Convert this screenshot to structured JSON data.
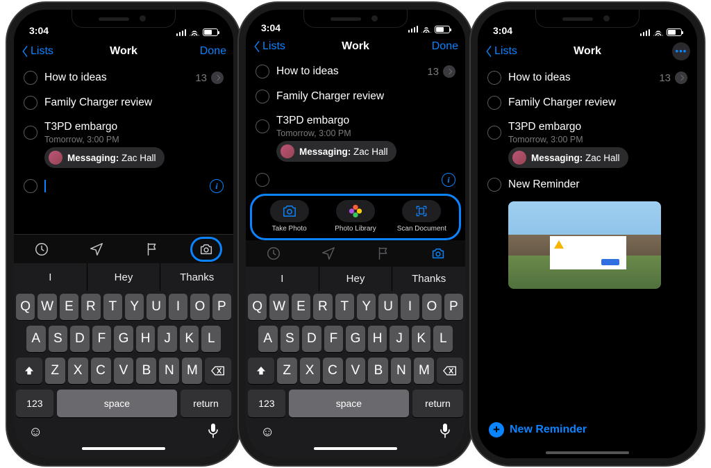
{
  "status": {
    "time": "3:04"
  },
  "nav": {
    "back": "Lists",
    "title": "Work",
    "done": "Done"
  },
  "reminders": [
    {
      "title": "How to ideas",
      "count": "13"
    },
    {
      "title": "Family Charger review"
    },
    {
      "title": "T3PD embargo",
      "sub": "Tomorrow, 3:00 PM"
    }
  ],
  "message_pill": {
    "prefix": "Messaging:",
    "name": "Zac Hall"
  },
  "new_reminder_label": "New Reminder",
  "actions": {
    "take_photo": "Take Photo",
    "photo_library": "Photo Library",
    "scan_document": "Scan Document"
  },
  "predictions": [
    "I",
    "Hey",
    "Thanks"
  ],
  "keyboard": {
    "row1": [
      "Q",
      "W",
      "E",
      "R",
      "T",
      "Y",
      "U",
      "I",
      "O",
      "P"
    ],
    "row2": [
      "A",
      "S",
      "D",
      "F",
      "G",
      "H",
      "J",
      "K",
      "L"
    ],
    "row3": [
      "Z",
      "X",
      "C",
      "V",
      "B",
      "N",
      "M"
    ],
    "numKey": "123",
    "space": "space",
    "ret": "return"
  },
  "bottom_button": "New Reminder"
}
